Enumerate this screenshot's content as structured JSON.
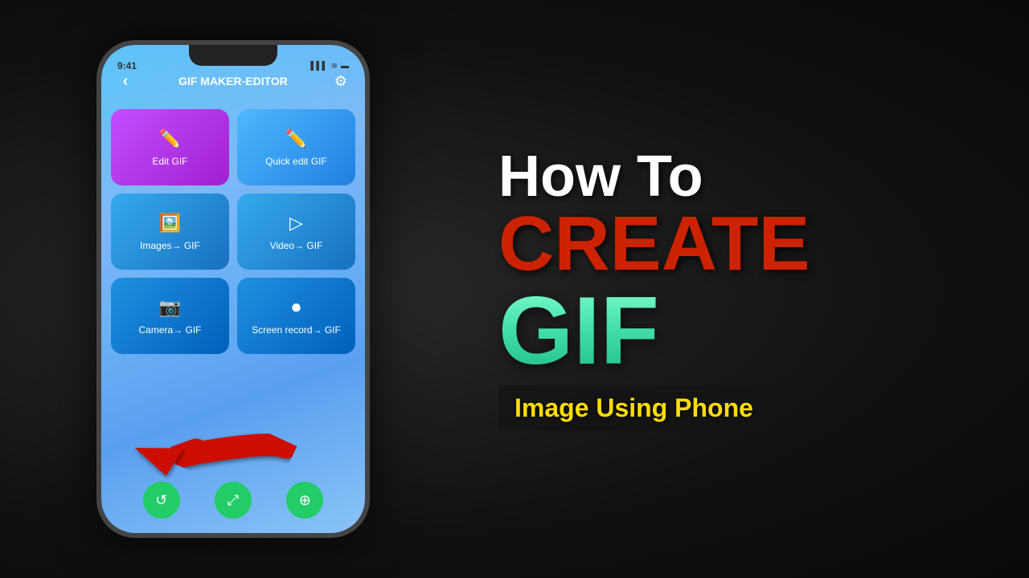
{
  "phone": {
    "status": {
      "time": "9:41",
      "signal": "▌▌▌",
      "wifi": "WiFi",
      "battery": "■"
    },
    "header": {
      "title": "GIF MAKER-EDITOR",
      "back_icon": "‹",
      "settings_icon": "⚙"
    },
    "buttons": [
      {
        "id": "edit-gif",
        "label": "Edit GIF",
        "icon": "✏",
        "style": "purple"
      },
      {
        "id": "quick-edit-gif",
        "label": "Quick edit GIF",
        "icon": "✏",
        "style": "blue-light"
      },
      {
        "id": "images-gif",
        "label": "Images→ GIF",
        "icon": "🖼",
        "style": "blue-mid"
      },
      {
        "id": "video-gif",
        "label": "Video→ GIF",
        "icon": "▷",
        "style": "blue-mid"
      },
      {
        "id": "camera-gif",
        "label": "Camera→ GIF",
        "icon": "📷",
        "style": "blue-dark"
      },
      {
        "id": "screen-record-gif",
        "label": "Screen record→ GIF",
        "icon": "⏺",
        "style": "blue-dark"
      }
    ],
    "bottom_tabs": [
      {
        "id": "tab1",
        "icon": "↺"
      },
      {
        "id": "tab2",
        "icon": "⤢"
      },
      {
        "id": "tab3",
        "icon": "⊕"
      }
    ]
  },
  "hero_text": {
    "line1": "How To",
    "line2": "CREATE",
    "line3": "GIF",
    "subtitle": "Image Using Phone"
  }
}
